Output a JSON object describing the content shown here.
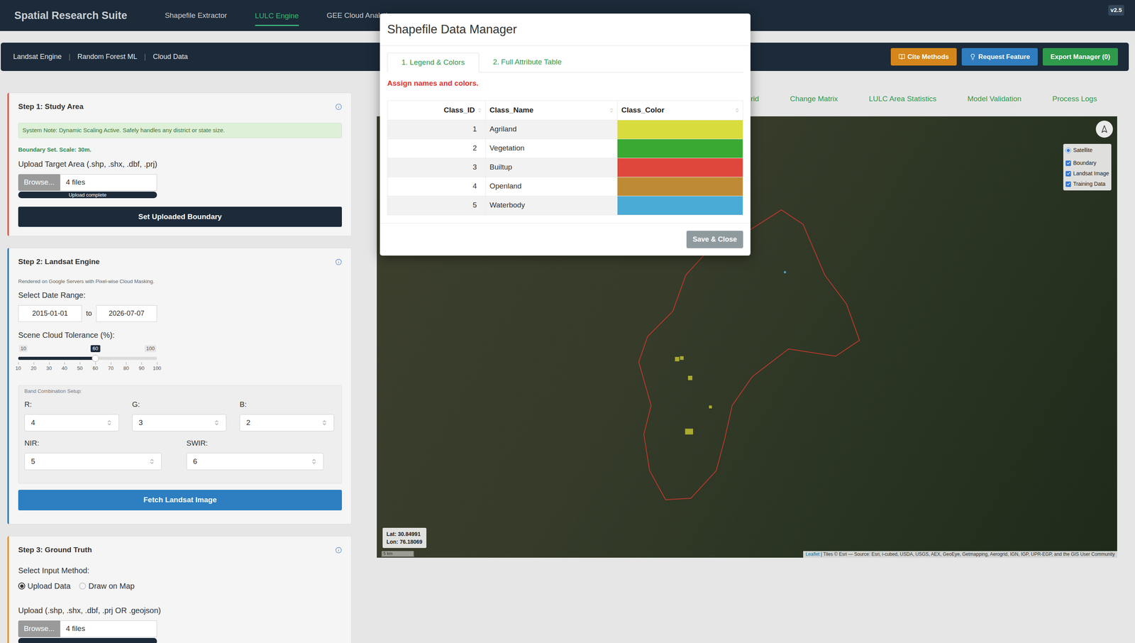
{
  "app": {
    "title": "Spatial Research Suite",
    "version": "v2.5"
  },
  "nav": [
    {
      "label": "Shapefile Extractor",
      "selected": false
    },
    {
      "label": "LULC Engine",
      "selected": true
    },
    {
      "label": "GEE Cloud Analytic",
      "selected": false
    }
  ],
  "subnav": {
    "items": [
      "Landsat Engine",
      "Random Forest ML",
      "Cloud Data"
    ],
    "separator": "|"
  },
  "actions": [
    {
      "label": "Cite Methods",
      "color": "#d4861a"
    },
    {
      "label": "Request Feature",
      "color": "#2f7dbf"
    },
    {
      "label": "Export Manager (0)",
      "color": "#2e9a4c"
    }
  ],
  "sidebar": {
    "step1": {
      "title": "Step 1: Study Area",
      "color": "#e05a4a",
      "note": "System Note: Dynamic Scaling Active. Safely handles any district or state size.",
      "status": "Boundary Set. Scale: 30m.",
      "upload_label": "Upload Target Area (.shp, .shx, .dbf, .prj)",
      "file_input": {
        "button": "Browse...",
        "value": "4 files",
        "progress": {
          "level": 1,
          "label": "Upload complete"
        }
      },
      "button": "Set Uploaded Boundary"
    },
    "step2": {
      "title": "Step 2: Landsat Engine",
      "color": "#2f7dbf",
      "subtitle": "Rendered on Google Servers with Pixel-wise Cloud Masking.",
      "date_label": "Select Date Range:",
      "date_from": "2015-01-01",
      "date_sep": "to",
      "date_to": "2026-07-07",
      "slider": {
        "label": "Scene Cloud Tolerance (%):",
        "min": "10",
        "max": "100",
        "value": "60",
        "level": 0.556,
        "ticks": [
          "10",
          "20",
          "30",
          "40",
          "50",
          "60",
          "70",
          "80",
          "90",
          "100"
        ]
      },
      "bands": {
        "title": "Band Combination Setup:",
        "row1": [
          {
            "label": "R:",
            "value": "4"
          },
          {
            "label": "G:",
            "value": "3"
          },
          {
            "label": "B:",
            "value": "2"
          }
        ],
        "row2": [
          {
            "label": "NIR:",
            "value": "5"
          },
          {
            "label": "SWIR:",
            "value": "6"
          }
        ]
      },
      "button": "Fetch Landsat Image"
    },
    "step3": {
      "title": "Step 3: Ground Truth",
      "color": "#e8922a",
      "method_label": "Select Input Method:",
      "methods": [
        {
          "label": "Upload Data",
          "selected": true
        },
        {
          "label": "Draw on Map",
          "selected": false
        }
      ],
      "upload_label": "Upload (.shp, .shx, .dbf, .prj OR .geojson)",
      "file_input": {
        "button": "Browse...",
        "value": "4 files",
        "progress": {
          "level": 1
        }
      }
    }
  },
  "map": {
    "tabs": [
      {
        "label": "Grid",
        "selected": false
      },
      {
        "label": "Change Matrix",
        "selected": false
      },
      {
        "label": "LULC Area Statistics",
        "selected": false
      },
      {
        "label": "Model Validation",
        "selected": false
      },
      {
        "label": "Process Logs",
        "selected": false
      }
    ],
    "layers": [
      {
        "label": "Satellite",
        "kind": "radio",
        "checked": true
      },
      {
        "label": "Boundary",
        "kind": "checkbox",
        "checked": true
      },
      {
        "label": "Landsat Image",
        "kind": "checkbox",
        "checked": true
      },
      {
        "label": "Training Data",
        "kind": "checkbox",
        "checked": true
      }
    ],
    "coords": {
      "lat": "Lat: 30.84991",
      "lon": "Lon: 76.18069"
    },
    "scale": "5 km",
    "attribution": {
      "link": "Leaflet",
      "text": "| Tiles © Esri — Source: Esri, i-cubed, USDA, USGS, AEX, GeoEye, Getmapping, Aerogrid, IGN, IGP, UPR-EGP, and the GIS User Community"
    }
  },
  "modal": {
    "title": "Shapefile Data Manager",
    "tabs": [
      {
        "label": "1. Legend & Colors",
        "selected": true
      },
      {
        "label": "2. Full Attribute Table",
        "selected": false
      }
    ],
    "hint": "Assign names and colors.",
    "table": {
      "columns": [
        "Class_ID",
        "Class_Name",
        "Class_Color"
      ],
      "rows": [
        {
          "id": "1",
          "name": "Agriland",
          "color": "#d8dc3c"
        },
        {
          "id": "2",
          "name": "Vegetation",
          "color": "#3aa932"
        },
        {
          "id": "3",
          "name": "Builtup",
          "color": "#e0473c"
        },
        {
          "id": "4",
          "name": "Openland",
          "color": "#bf8a35"
        },
        {
          "id": "5",
          "name": "Waterbody",
          "color": "#4aabd6"
        }
      ]
    },
    "button": "Save & Close"
  }
}
